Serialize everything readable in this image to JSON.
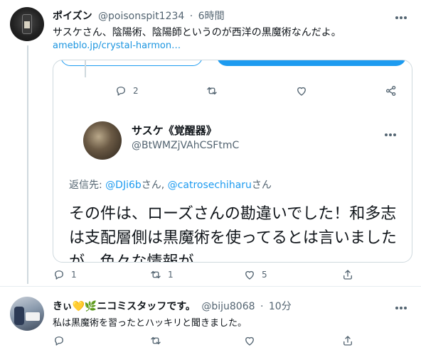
{
  "tweet1": {
    "name": "ポイズン",
    "handle": "@poisonspit1234",
    "time": "6時間",
    "text": "サスケさん、陰陽術、陰陽師というのが西洋の黒魔術なんだよ。",
    "link": "ameblo.jp/crystal-harmon…",
    "actions": {
      "reply_count": "1",
      "retweet_count": "1",
      "like_count": "5"
    },
    "quoted": {
      "actions": {
        "reply_count": "2"
      },
      "name": "サスケ《覚醒器》",
      "handle": "@BtWMZjVAhCSFtmC",
      "reply_prefix": "返信先: ",
      "mention1": "@DJi6b",
      "mention1_suffix": "さん, ",
      "mention2": "@catrosechiharu",
      "mention2_suffix": "さん",
      "text": "その件は、ローズさんの勘違いでした！和多志は支配層側は黒魔術を使ってるとは言いましたが、色々な情報が"
    }
  },
  "tweet2": {
    "name": "きぃ💛🌿ニコミスタッフです。",
    "handle": "@biju8068",
    "time": "10分",
    "text": "私は黒魔術を習ったとハッキリと聞きました。"
  },
  "colors": {
    "accent": "#1d9bf0",
    "link": "#1b95e0",
    "secondary_text": "#536471",
    "border": "#cfd9de"
  },
  "icons": [
    "reply-icon",
    "retweet-icon",
    "like-icon",
    "share-icon",
    "more-icon"
  ]
}
